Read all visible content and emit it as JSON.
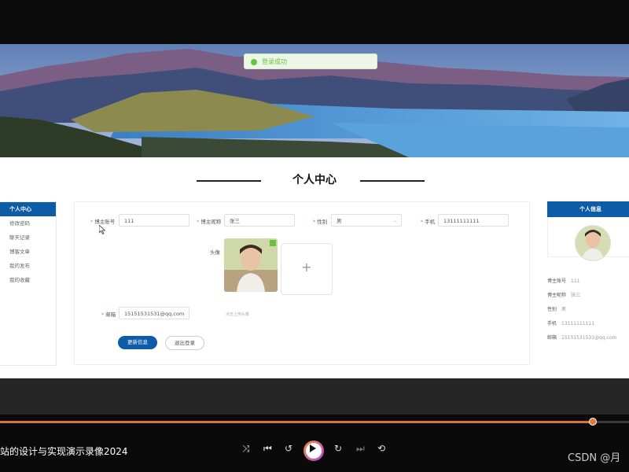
{
  "toast": {
    "text": "登录成功"
  },
  "page_title": "个人中心",
  "left_menu": {
    "active": "个人中心",
    "items": [
      "修改密码",
      "聊天记录",
      "博客文章",
      "我的发布",
      "我的收藏"
    ]
  },
  "form": {
    "account_label": "博主账号",
    "account_value": "111",
    "nickname_label": "博主昵称",
    "nickname_value": "张三",
    "gender_label": "性别",
    "gender_value": "男",
    "phone_label": "手机",
    "phone_value": "13111111111",
    "avatar_label": "头像",
    "upload_hint": "点击上传头像",
    "email_label": "邮箱",
    "email_value": "15151531531@qq.com",
    "update_button": "更新信息",
    "logout_button": "退出登录"
  },
  "info_card": {
    "header": "个人信息",
    "rows": [
      {
        "label": "博主账号",
        "value": "111"
      },
      {
        "label": "博主昵称",
        "value": "张三"
      },
      {
        "label": "性别",
        "value": "男"
      },
      {
        "label": "手机",
        "value": "13111111111"
      },
      {
        "label": "邮箱",
        "value": "15151531531@qq.com"
      }
    ]
  },
  "player": {
    "title": "站的设计与实现演示录像2024",
    "progress": 0.943,
    "watermark": "CSDN @月",
    "icons": [
      "shuffle-icon",
      "previous-icon",
      "rewind-icon",
      "play-icon",
      "forward-icon",
      "next-icon",
      "loop-icon"
    ]
  },
  "colors": {
    "primary": "#0d5ca8",
    "success": "#67c23a",
    "progress": "#d9733b"
  }
}
